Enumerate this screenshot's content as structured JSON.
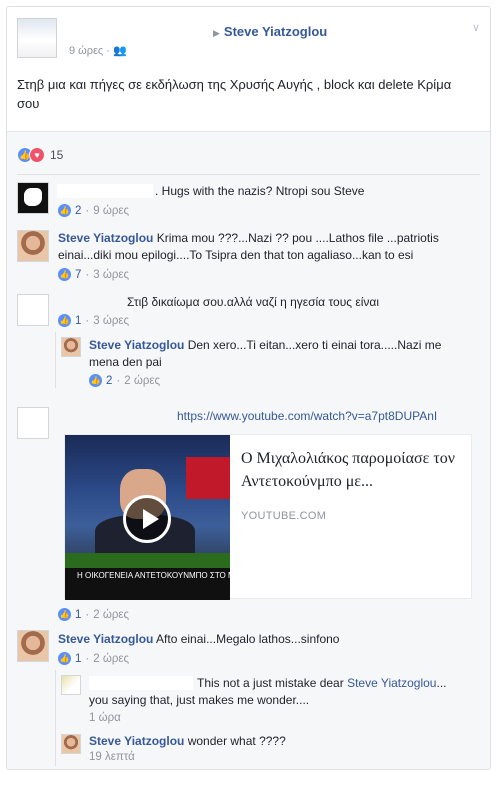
{
  "post": {
    "author": "Steve Yiatzoglou",
    "time": "9 ώρες",
    "audience_icon": "friends-icon",
    "text": "Στηβ μια και πήγες σε εκδήλωση της Χρυσής Αυγής , block και delete Κρίμα σου",
    "reaction_count": "15"
  },
  "comments": [
    {
      "text": ". Hugs with the nazis? Ntropi sou Steve",
      "likes": "2",
      "time": "9 ώρες"
    },
    {
      "author": "Steve Yiatzoglou",
      "text_line1": "Krima mou ???...Nazi ?? pou ....Lathos file ...patriotis",
      "text_line2": "einai...diki mou epilogi....To Tsipra den that ton agaliaso...kan to esi",
      "likes": "7",
      "time": "3 ώρες"
    },
    {
      "text": "Στιβ δικαίωμα σου.αλλά ναζί η ηγεσία τους είναι",
      "likes": "1",
      "time": "3 ώρες",
      "reply": {
        "author": "Steve Yiatzoglou",
        "text_line1": "Den xero...Ti eitan...xero ti einai tora.....Nazi me",
        "text_line2": "mena den pai",
        "likes": "2",
        "time": "2 ώρες"
      }
    },
    {
      "link": "https://www.youtube.com/watch?v=a7pt8DUPAnI",
      "share": {
        "title": "Ο Μιχαλολιάκος παρομοίασε τον Αντετοκούνμπο με...",
        "source": "YOUTUBE.COM",
        "banner": "Η ΟΙΚΟΓΕΝΕΙΑ ΑΝΤΕΤΟΚΟΥΝΜΠΟ ΣΤΟ ΜΑΞ"
      },
      "likes": "1",
      "time": "2 ώρες"
    },
    {
      "author": "Steve Yiatzoglou",
      "text": "Afto einai...Megalo lathos...sinfono",
      "likes": "1",
      "time": "2 ώρες",
      "replies": [
        {
          "text_before": "This not a just mistake dear",
          "mention": "Steve Yiatzoglou",
          "text_after": "...",
          "text_line2": "you saying that, just makes me wonder....",
          "time": "1 ώρα"
        },
        {
          "author": "Steve Yiatzoglou",
          "text": "wonder what ????",
          "time": "19 λεπτά"
        }
      ]
    }
  ],
  "colors": {
    "link": "#365899",
    "meta": "#90949c",
    "like": "#5890ff",
    "love": "#f25268"
  }
}
